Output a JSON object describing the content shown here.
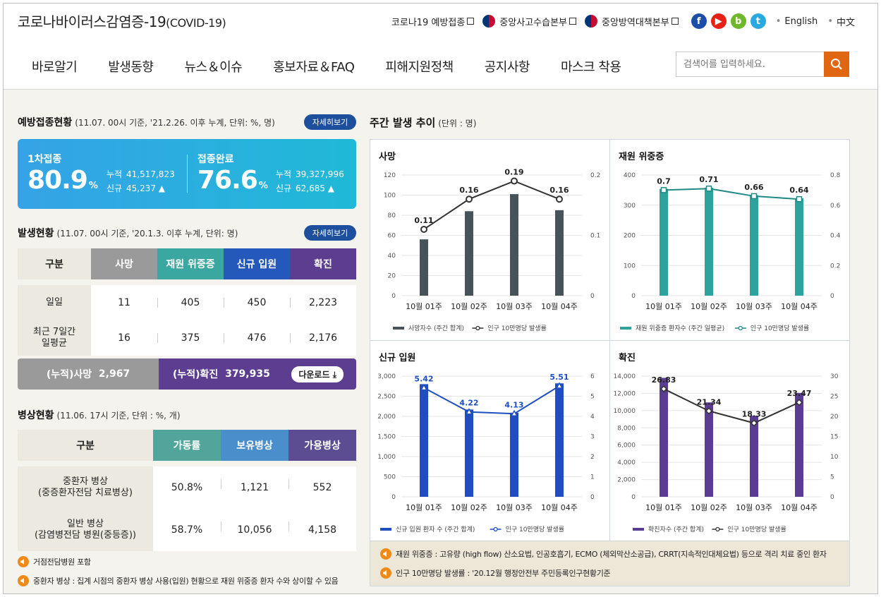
{
  "header": {
    "title_main": "코로나바이러스감염증-19",
    "title_sub": "(COVID-19)",
    "util_links": [
      "코로나19 예방접종",
      "중앙사고수습본부",
      "중앙방역대책본부"
    ],
    "sns": [
      {
        "icon": "facebook-icon",
        "glyph": "f",
        "color": "#1d4ea8"
      },
      {
        "icon": "youtube-icon",
        "glyph": "▶",
        "color": "#e62117"
      },
      {
        "icon": "blog-icon",
        "glyph": "b",
        "color": "#6fb82c"
      },
      {
        "icon": "twitter-icon",
        "glyph": "t",
        "color": "#2aa9e0"
      }
    ],
    "lang": [
      "English",
      "中文"
    ],
    "nav": [
      "바로알기",
      "발생동향",
      "뉴스＆이슈",
      "홍보자료＆FAQ",
      "피해지원정책",
      "공지사항",
      "마스크 착용"
    ],
    "search_placeholder": "검색어를 입력하세요."
  },
  "vaccination": {
    "title": "예방접종현황",
    "note": "(11.07. 00시 기준, '21.2.26. 이후 누계, 단위: %, 명)",
    "more": "자세히보기",
    "first": {
      "label": "1차접종",
      "pct": "80.9",
      "unit": "%",
      "cum_label": "누적",
      "cum": "41,517,823",
      "new_label": "신규",
      "new": "45,237 ▲"
    },
    "full": {
      "label": "접종완료",
      "pct": "76.6",
      "unit": "%",
      "cum_label": "누적",
      "cum": "39,327,996",
      "new_label": "신규",
      "new": "62,685 ▲"
    }
  },
  "occurrence": {
    "title": "발생현황",
    "note": "(11.07. 00시 기준, '20.1.3. 이후 누계, 단위: 명)",
    "more": "자세히보기",
    "headers": [
      "구분",
      "사망",
      "재원 위중증",
      "신규 입원",
      "확진"
    ],
    "header_colors": [
      "#eceae0",
      "#9a9a9a",
      "#3aa7a0",
      "#2458bb",
      "#5c3d8f"
    ],
    "rows": [
      {
        "label": "일일",
        "values": [
          "11",
          "405",
          "450",
          "2,223"
        ]
      },
      {
        "label": "최근 7일간\n일평균",
        "values": [
          "16",
          "375",
          "476",
          "2,176"
        ]
      }
    ],
    "cum_death_label": "(누적)사망",
    "cum_death": "2,967",
    "cum_conf_label": "(누적)확진",
    "cum_conf": "379,935",
    "download": "다운로드"
  },
  "beds": {
    "title": "병상현황",
    "note": "(11.06. 17시 기준, 단위 : %, 개)",
    "headers": [
      "구분",
      "가동률",
      "보유병상",
      "가용병상"
    ],
    "header_colors": [
      "#eceae0",
      "#52a59a",
      "#4a8fcb",
      "#5c4d92"
    ],
    "rows": [
      {
        "label": "중환자 병상\n(중증환자전담 치료병상)",
        "values": [
          "50.8%",
          "1,121",
          "552"
        ]
      },
      {
        "label": "일반 병상\n(감염병전담 병원(중등증))",
        "values": [
          "58.7%",
          "10,056",
          "4,158"
        ]
      }
    ],
    "notes": [
      "거점전담병원 포함",
      "중환자 병상 : 집계 시점의 중환자 병상 사용(입원) 현황으로 재원 위중증 환자 수와 상이할 수 있음"
    ]
  },
  "weekly": {
    "title": "주간 발생 추이",
    "note": "(단위 : 명)",
    "footnotes": [
      "재원 위중증 : 고유량 (high flow) 산소요법, 인공호흡기, ECMO (체외막산소공급), CRRT(지속적인대체요법) 등으로 격리 치료 중인 환자",
      "인구 10만명당 발생률 : '20.12월 행정안전부 주민등록인구현황기준"
    ]
  },
  "chart_data": [
    {
      "type": "bar",
      "title": "사망",
      "categories": [
        "10월 01주",
        "10월 02주",
        "10월 03주",
        "10월 04주"
      ],
      "series": [
        {
          "name": "사망자수 (주간 합계)",
          "values": [
            56,
            84,
            101,
            85
          ],
          "axis": "left",
          "kind": "bar"
        },
        {
          "name": "인구 10만명당 발생률",
          "values": [
            0.11,
            0.16,
            0.19,
            0.16
          ],
          "labels": [
            "0.11",
            "0.16",
            "0.19",
            "0.16"
          ],
          "axis": "right",
          "kind": "line"
        }
      ],
      "ylim": [
        0,
        120
      ],
      "yticks": [
        "0",
        "20",
        "40",
        "60",
        "80",
        "100",
        "120"
      ],
      "y2lim": [
        0,
        0.2
      ],
      "y2ticks": [
        "0",
        "0.1",
        "0.2"
      ],
      "bar_color": "#465359",
      "line_color": "#333333",
      "marker": "circle"
    },
    {
      "type": "bar",
      "title": "재원 위중증",
      "categories": [
        "10월 01주",
        "10월 02주",
        "10월 03주",
        "10월 04주"
      ],
      "series": [
        {
          "name": "재원 위중증 환자수 (주간 일평균)",
          "values": [
            354,
            358,
            333,
            323
          ],
          "axis": "left",
          "kind": "bar"
        },
        {
          "name": "인구 10만명당 발생률",
          "values": [
            0.7,
            0.71,
            0.66,
            0.64
          ],
          "labels": [
            "0.7",
            "0.71",
            "0.66",
            "0.64"
          ],
          "axis": "right",
          "kind": "line"
        }
      ],
      "ylim": [
        0,
        400
      ],
      "yticks": [
        "0",
        "100",
        "200",
        "300",
        "400"
      ],
      "y2lim": [
        0,
        0.8
      ],
      "y2ticks": [
        "0",
        "0.2",
        "0.4",
        "0.6",
        "0.8"
      ],
      "bar_color": "#2ea39d",
      "line_color": "#1f8a86",
      "marker": "square"
    },
    {
      "type": "bar",
      "title": "신규 입원",
      "categories": [
        "10월 01주",
        "10월 02주",
        "10월 03주",
        "10월 04주"
      ],
      "series": [
        {
          "name": "신규 입원 환자 수 (주간 합계)",
          "values": [
            2800,
            2170,
            2090,
            2820
          ],
          "axis": "left",
          "kind": "bar"
        },
        {
          "name": "인구 10만명당 발생률",
          "values": [
            5.42,
            4.22,
            4.13,
            5.51
          ],
          "labels": [
            "5.42",
            "4.22",
            "4.13",
            "5.51"
          ],
          "axis": "right",
          "kind": "line"
        }
      ],
      "ylim": [
        0,
        3000
      ],
      "yticks": [
        "0",
        "500",
        "1,000",
        "1,500",
        "2,000",
        "2,500",
        "3,000"
      ],
      "y2lim": [
        0,
        6
      ],
      "y2ticks": [
        "0",
        "1",
        "2",
        "3",
        "4",
        "5",
        "6"
      ],
      "bar_color": "#1f4fbf",
      "line_color": "#1f4fbf",
      "marker": "triangle"
    },
    {
      "type": "bar",
      "title": "확진",
      "categories": [
        "10월 01주",
        "10월 02주",
        "10월 03주",
        "10월 04주"
      ],
      "series": [
        {
          "name": "확진자수 (주간 합계)",
          "values": [
            13800,
            10950,
            9400,
            12050
          ],
          "axis": "left",
          "kind": "bar"
        },
        {
          "name": "인구 10만명당 발생률",
          "values": [
            26.83,
            21.34,
            18.33,
            23.47
          ],
          "labels": [
            "26.83",
            "21.34",
            "18.33",
            "23.47"
          ],
          "axis": "right",
          "kind": "line"
        }
      ],
      "ylim": [
        0,
        14000
      ],
      "yticks": [
        "0",
        "2,000",
        "4,000",
        "6,000",
        "8,000",
        "10,000",
        "12,000",
        "14,000"
      ],
      "y2lim": [
        0,
        30
      ],
      "y2ticks": [
        "0",
        "5",
        "10",
        "15",
        "20",
        "25",
        "30"
      ],
      "bar_color": "#5a3d90",
      "line_color": "#333333",
      "marker": "diamond"
    }
  ]
}
